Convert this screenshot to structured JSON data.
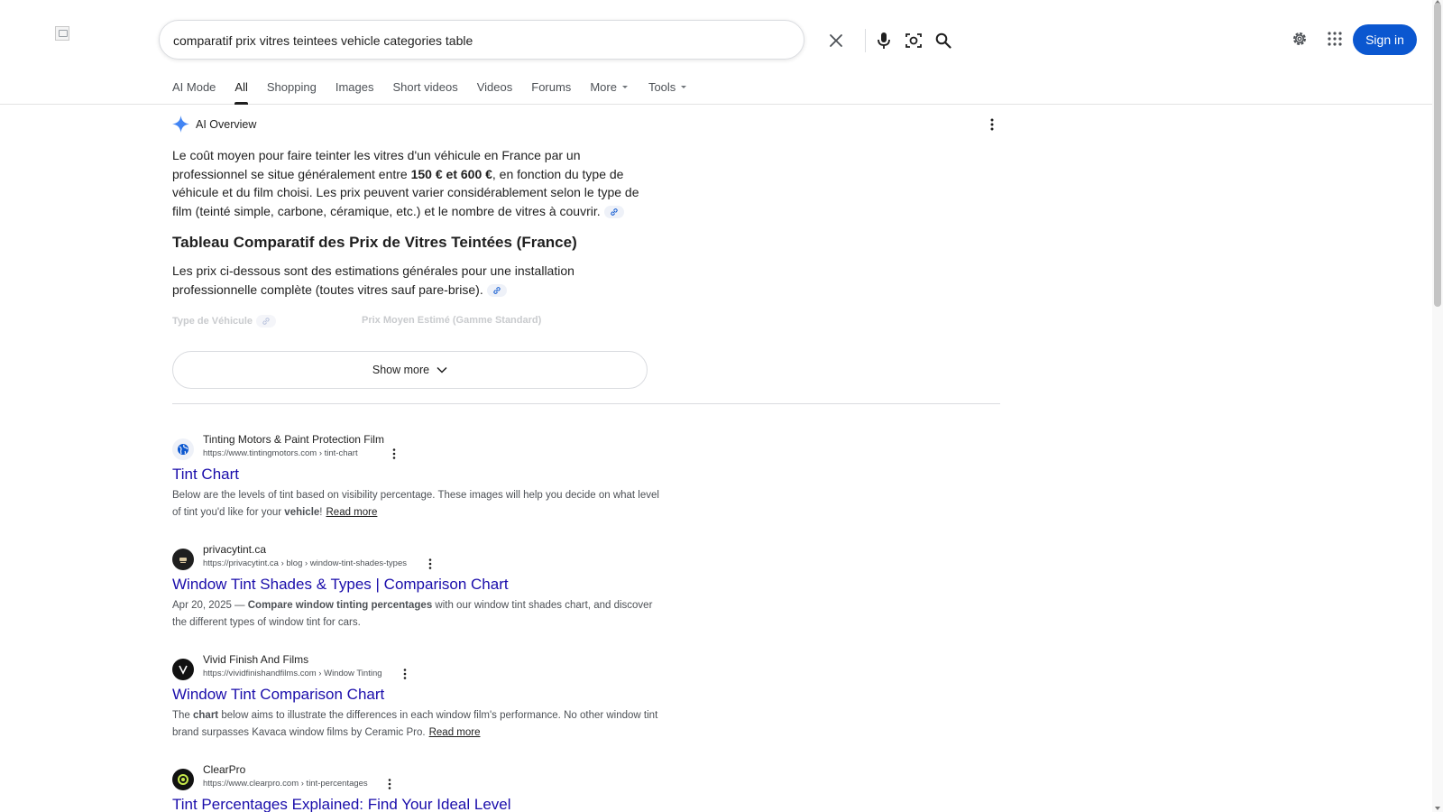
{
  "search": {
    "query": "comparatif prix vitres teintees vehicle categories table"
  },
  "header": {
    "sign_in": "Sign in"
  },
  "tabs": [
    {
      "label": "AI Mode"
    },
    {
      "label": "All"
    },
    {
      "label": "Shopping"
    },
    {
      "label": "Images"
    },
    {
      "label": "Short videos"
    },
    {
      "label": "Videos"
    },
    {
      "label": "Forums"
    },
    {
      "label": "More"
    },
    {
      "label": "Tools"
    }
  ],
  "ai_overview": {
    "title": "AI Overview",
    "para1_a": "Le coût moyen pour faire teinter les vitres d'un véhicule en France par un professionnel se situe généralement entre ",
    "para1_bold": "150 € et 600 €",
    "para1_b": ", en fonction du type de véhicule et du film choisi. Les prix peuvent varier considérablement selon le type de film (teinté simple, carbone, céramique, etc.) et le nombre de vitres à couvrir.",
    "heading": "Tableau Comparatif des Prix de Vitres Teintées (France)",
    "para2": "Les prix ci-dessous sont des estimations générales pour une installation professionnelle complète (toutes vitres sauf pare-brise).",
    "table_col1": "Type de Véhicule",
    "table_col2": "Prix Moyen Estimé (Gamme Standard)",
    "show_more": "Show more"
  },
  "results": [
    {
      "site": "Tinting Motors & Paint Protection Film",
      "url": "https://www.tintingmotors.com › tint-chart",
      "title": "Tint Chart",
      "snippet_a": "Below are the levels of tint based on visibility percentage. These images will help you decide on what level of tint you'd like for your ",
      "snippet_bold": "vehicle",
      "snippet_b": "!",
      "read_more": "Read more"
    },
    {
      "site": "privacytint.ca",
      "url": "https://privacytint.ca › blog › window-tint-shades-types",
      "title": "Window Tint Shades & Types | Comparison Chart",
      "snippet_a": "Apr 20, 2025 — ",
      "snippet_bold": "Compare window tinting percentages",
      "snippet_b": " with our window tint shades chart, and discover the different types of window tint for cars."
    },
    {
      "site": "Vivid Finish And Films",
      "url": "https://vividfinishandfilms.com › Window Tinting",
      "title": "Window Tint Comparison Chart",
      "snippet_a": "The ",
      "snippet_bold": "chart",
      "snippet_b": " below aims to illustrate the differences in each window film's performance. No other window tint brand surpasses Kavaca window films by Ceramic Pro.",
      "read_more": "Read more"
    },
    {
      "site": "ClearPro",
      "url": "https://www.clearpro.com › tint-percentages",
      "title": "Tint Percentages Explained: Find Your Ideal Level"
    }
  ],
  "colors": {
    "link": "#1a0dab",
    "accent": "#0b57d0"
  }
}
